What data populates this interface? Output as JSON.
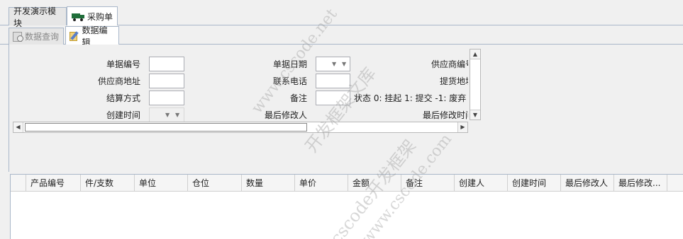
{
  "top_tabs": [
    {
      "label": "开发演示模块",
      "active": false
    },
    {
      "label": "采购单",
      "active": true,
      "icon": "truck-icon"
    }
  ],
  "sub_tabs": [
    {
      "label": "数据查询",
      "active": false,
      "icon": "document-search-icon"
    },
    {
      "label": "数据编辑",
      "active": true,
      "icon": "edit-icon"
    }
  ],
  "form": {
    "bill_no_label": "单据编号",
    "bill_no_value": "",
    "bill_date_label": "单据日期",
    "supplier_code_label": "供应商编号",
    "supplier_address_label": "供应商地址",
    "supplier_address_value": "",
    "phone_label": "联系电话",
    "phone_value": "",
    "pickup_address_label": "提货地址",
    "settlement_label": "结算方式",
    "settlement_value": "",
    "remark_label": "备注",
    "remark_value": "",
    "status_note": "状态 0: 挂起 1: 提交 -1: 废弃",
    "created_time_label": "创建时间",
    "last_modifier_label": "最后修改人",
    "last_modified_time_label": "最后修改时间"
  },
  "grid": {
    "columns": [
      "产品编号",
      "件/支数",
      "单位",
      "仓位",
      "数量",
      "单价",
      "金额",
      "备注",
      "创建人",
      "创建时间",
      "最后修改人",
      "最后修改..."
    ],
    "rows": []
  },
  "watermark": {
    "line1": "www.cscode.net",
    "line2": "开发框架文库",
    "line3": "cscode开发框架",
    "line4": "www.cscode.com"
  }
}
